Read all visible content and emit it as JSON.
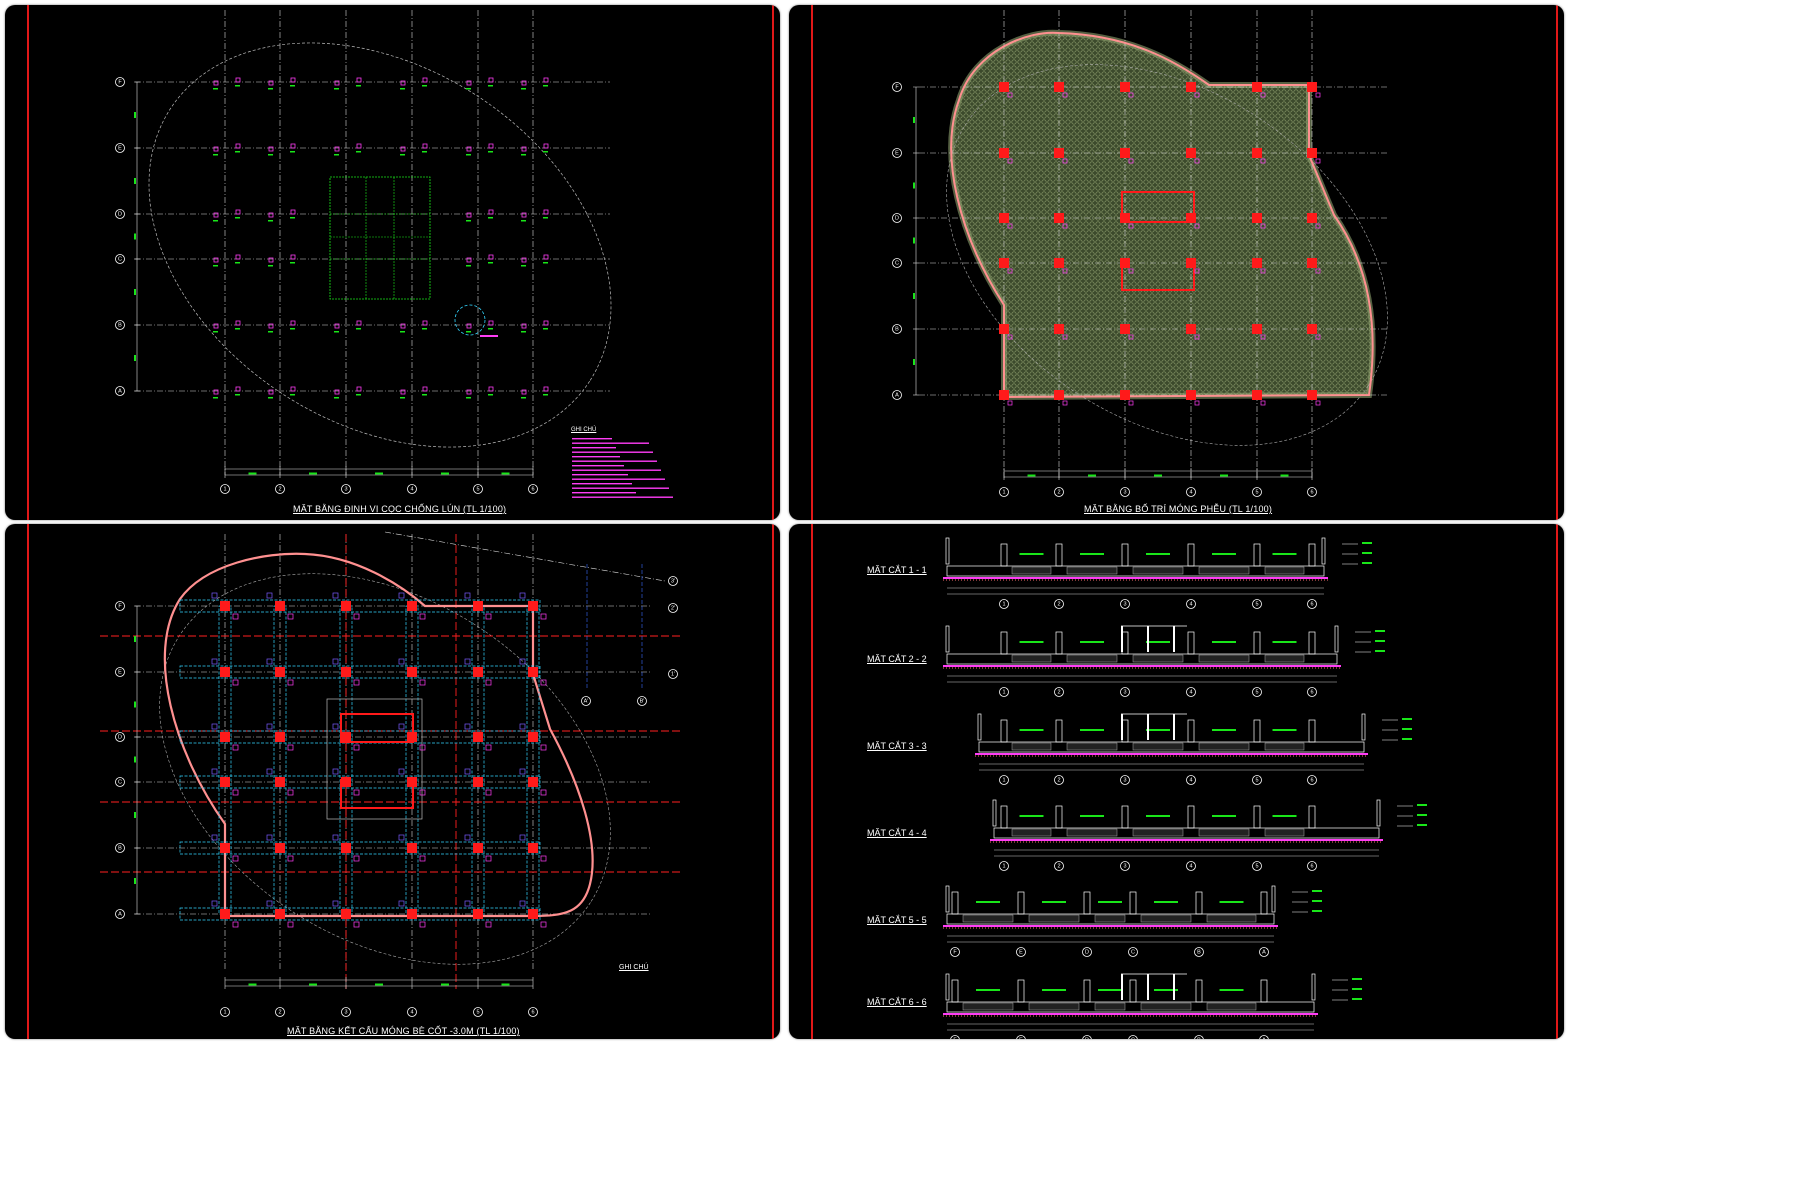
{
  "panels": {
    "p1": {
      "title": "MẶT BẰNG ĐỊNH VỊ CỌC CHỐNG LÚN (TL 1/100)"
    },
    "p2": {
      "title": "MẶT BẰNG BỐ TRÍ MÓNG PHỄU (TL 1/100)"
    },
    "p3": {
      "title": "MẶT BẰNG KẾT CẤU MÓNG BÈ CỐT -3.0M (TL 1/100)",
      "note_heading": "GHI CHÚ"
    },
    "p4": {
      "sections": [
        "MẶT CẮT 1 - 1",
        "MẶT CẮT 2 - 2",
        "MẶT CẮT 3 - 3",
        "MẶT CẮT 4 - 4",
        "MẶT CẮT 5 - 5",
        "MẶT CẮT 6 - 6"
      ]
    }
  },
  "notes": {
    "heading": "GHI CHÚ"
  },
  "grid": {
    "rows": [
      "F",
      "E",
      "D",
      "C",
      "B",
      "A"
    ],
    "cols": [
      "1",
      "2",
      "3",
      "4",
      "5",
      "6"
    ],
    "p3_extra": [
      "3'",
      "2'",
      "1'",
      "A'",
      "B'"
    ]
  },
  "colors": {
    "background": "#000000",
    "grid": "#d8d8d8",
    "dimension": "#19e619",
    "pile_marker": "#ff3df6",
    "column": "#ff1a1a",
    "outline": "#ff9090",
    "hatch": "#8a9a6a",
    "beam": "#33d6ff",
    "section_cut": "#ff2020"
  }
}
